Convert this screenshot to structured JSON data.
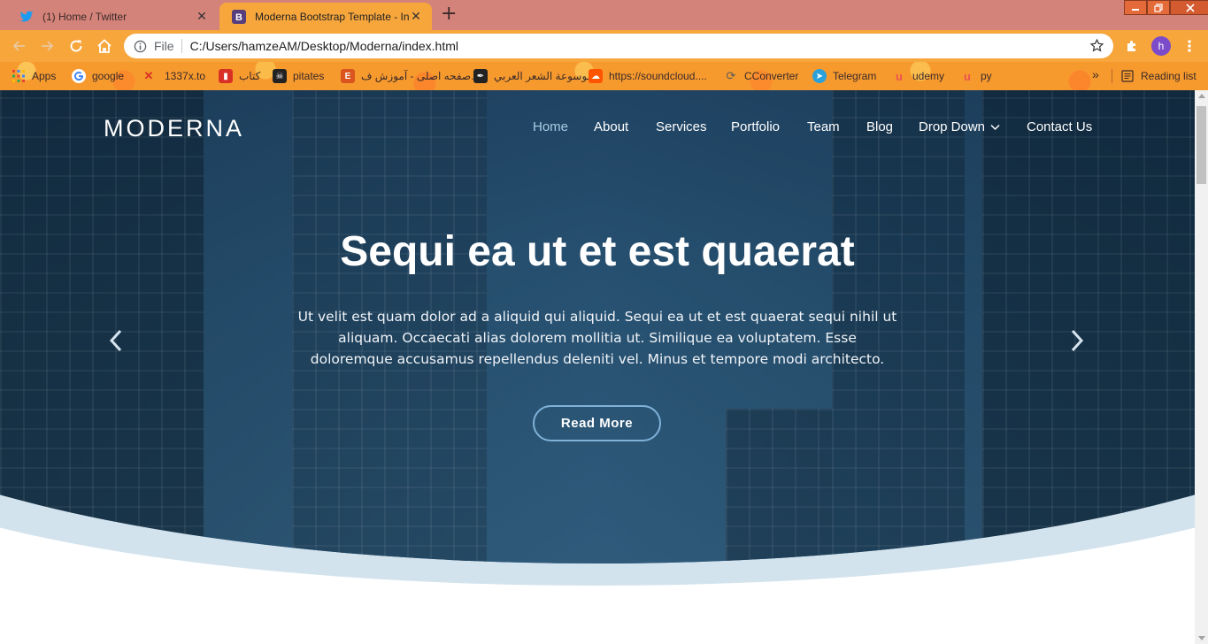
{
  "browser": {
    "tabs": [
      {
        "title": "(1) Home / Twitter",
        "icon": "twitter-icon",
        "active": false
      },
      {
        "title": "Moderna Bootstrap Template - In",
        "icon": "bootstrap-icon",
        "active": true
      }
    ],
    "new_tab": "+",
    "window_controls": {
      "minimize": "▁",
      "restore": "❐",
      "close": "X"
    },
    "address": {
      "scheme_label": "File",
      "url": "C:/Users/hamzeAM/Desktop/Moderna/index.html"
    },
    "profile_initial": "h",
    "bookmarks": [
      {
        "label": "Apps",
        "icon": "apps-grid-icon"
      },
      {
        "label": "google",
        "icon": "google-icon"
      },
      {
        "label": "1337x.to",
        "icon": "x-logo-icon"
      },
      {
        "label": "کتاب",
        "icon": "book-icon"
      },
      {
        "label": "pitates",
        "icon": "pirate-icon"
      },
      {
        "label": "صفحه اصلی - آموزش ف...",
        "icon": "e-icon"
      },
      {
        "label": "موسوعة الشعر العربي",
        "icon": "quill-icon"
      },
      {
        "label": "https://soundcloud....",
        "icon": "soundcloud-icon"
      },
      {
        "label": "CConverter",
        "icon": "cconverter-icon"
      },
      {
        "label": "Telegram",
        "icon": "telegram-icon"
      },
      {
        "label": "udemy",
        "icon": "udemy-icon"
      },
      {
        "label": "py",
        "icon": "udemy-icon"
      }
    ],
    "bookmarks_more": "»",
    "reading_list": "Reading list"
  },
  "site": {
    "logo": "MODERNA",
    "nav": [
      "Home",
      "About",
      "Services",
      "Portfolio",
      "Team",
      "Blog",
      "Drop Down",
      "Contact Us"
    ],
    "hero": {
      "title": "Sequi ea ut et est quaerat",
      "text": "Ut velit est quam dolor ad a aliquid qui aliquid. Sequi ea ut et est quaerat sequi nihil ut aliquam. Occaecati alias dolorem mollitia ut. Similique ea voluptatem. Esse doloremque accusamus repellendus deleniti vel. Minus et tempore modi architecto.",
      "button": "Read More"
    }
  },
  "colors": {
    "tabbar": "#d4837a",
    "toolbar": "#f7a63c",
    "hero_overlay": "#1c3e5c",
    "wave": "#d3e3ee",
    "nav_active": "#a9cbe6",
    "cta_border": "#7fb2d9"
  }
}
